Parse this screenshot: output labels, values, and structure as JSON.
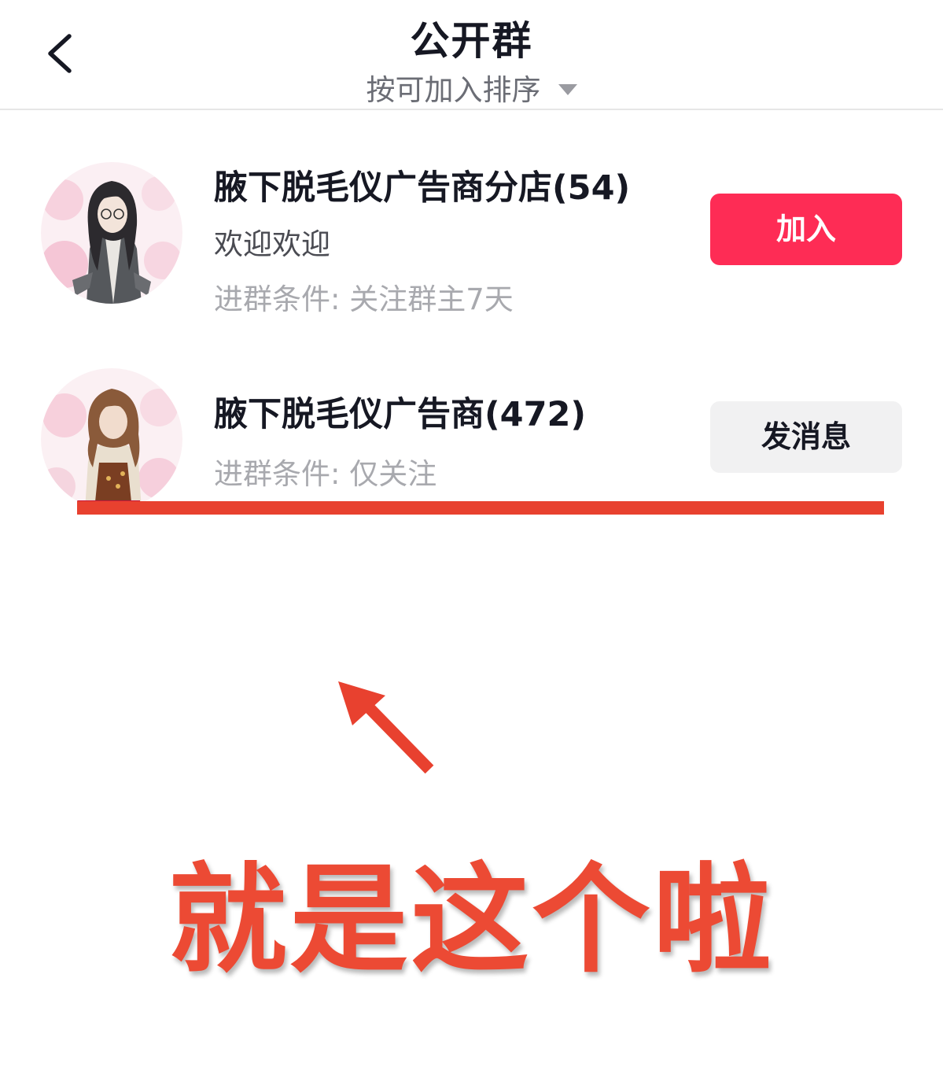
{
  "header": {
    "title": "公开群",
    "sort_label": "按可加入排序"
  },
  "groups": [
    {
      "name": "腋下脱毛仪广告商分店(54)",
      "description": "欢迎欢迎",
      "condition": "进群条件: 关注群主7天",
      "action_label": "加入"
    },
    {
      "name": "腋下脱毛仪广告商(472)",
      "condition": "进群条件: 仅关注",
      "action_label": "发消息"
    }
  ],
  "annotation": {
    "text": "就是这个啦",
    "color": "#ec4a34"
  },
  "colors": {
    "join_button": "#fe2c55",
    "message_button": "#f1f1f2",
    "annotation_red": "#e8412f"
  }
}
